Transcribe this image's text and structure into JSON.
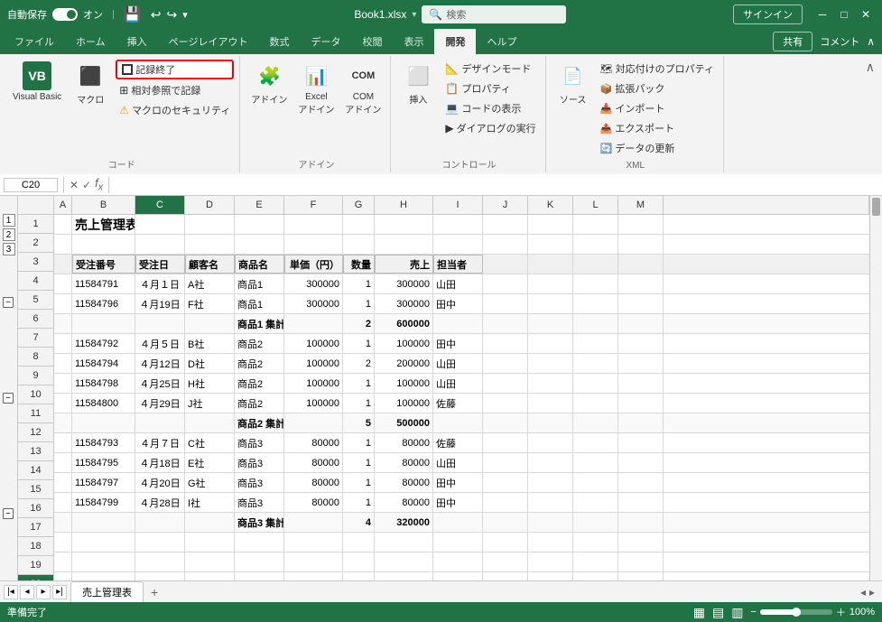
{
  "titlebar": {
    "autosave_label": "自動保存",
    "toggle_state": "オン",
    "filename": "Book1.xlsx",
    "search_placeholder": "検索",
    "signin_label": "サインイン",
    "win_min": "─",
    "win_max": "□",
    "win_close": "✕"
  },
  "ribbon": {
    "tabs": [
      "ファイル",
      "ホーム",
      "挿入",
      "ページレイアウト",
      "数式",
      "データ",
      "校閲",
      "表示",
      "開発",
      "ヘルプ"
    ],
    "active_tab": "開発",
    "share_label": "共有",
    "comment_label": "コメント",
    "groups": {
      "code": {
        "label": "コード",
        "vb_label": "Visual Basic",
        "macro_label": "マクロ",
        "record_label": "記録終了",
        "relative_label": "相対参照で記録",
        "security_label": "マクロのセキュリティ"
      },
      "addin": {
        "label": "アドイン",
        "addin_label": "アドイン",
        "excel_addin_label": "Excelアドイン",
        "com_label": "COM\nアドイン"
      },
      "insert_group": {
        "label": "アドイン",
        "insert_btn": "挿入"
      },
      "controls": {
        "label": "コントロール",
        "design_label": "デザインモード",
        "prop_label": "プロパティ",
        "code_view_label": "コードの表示",
        "dialog_label": "ダイアログの実行"
      },
      "xml": {
        "label": "XML",
        "source_label": "ソース",
        "map_prop_label": "対応付けのプロパティ",
        "extend_label": "拡張パック",
        "import_label": "インポート",
        "export_label": "エクスポート",
        "refresh_label": "データの更新"
      }
    }
  },
  "formula_bar": {
    "cell_ref": "C20",
    "formula_content": ""
  },
  "outline": {
    "levels": [
      "1",
      "2",
      "3"
    ],
    "minus_rows": [
      6,
      11,
      16
    ]
  },
  "columns": {
    "headers": [
      "A",
      "B",
      "C",
      "D",
      "E",
      "F",
      "G",
      "H",
      "I",
      "J",
      "K",
      "L",
      "M"
    ]
  },
  "sheet": {
    "title_row": "売上管理表",
    "headers": [
      "受注番号",
      "受注日",
      "顧客名",
      "商品名",
      "単価（円）",
      "数量",
      "売上",
      "担当者"
    ],
    "rows": [
      {
        "row": 4,
        "cols": [
          "11584791",
          "４月１日",
          "A社",
          "商品1",
          "300000",
          "1",
          "300000",
          "山田"
        ]
      },
      {
        "row": 5,
        "cols": [
          "11584796",
          "４月19日",
          "F社",
          "商品1",
          "300000",
          "1",
          "300000",
          "田中"
        ]
      },
      {
        "row": 6,
        "cols": [
          "",
          "",
          "",
          "商品1 集計",
          "",
          "2",
          "600000",
          ""
        ],
        "subtotal": true
      },
      {
        "row": 7,
        "cols": [
          "11584792",
          "４月５日",
          "B社",
          "商品2",
          "100000",
          "1",
          "100000",
          "田中"
        ]
      },
      {
        "row": 8,
        "cols": [
          "11584794",
          "４月12日",
          "D社",
          "商品2",
          "100000",
          "2",
          "200000",
          "山田"
        ]
      },
      {
        "row": 9,
        "cols": [
          "11584798",
          "４月25日",
          "H社",
          "商品2",
          "100000",
          "1",
          "100000",
          "山田"
        ]
      },
      {
        "row": 10,
        "cols": [
          "11584800",
          "４月29日",
          "J社",
          "商品2",
          "100000",
          "1",
          "100000",
          "佐藤"
        ]
      },
      {
        "row": 11,
        "cols": [
          "",
          "",
          "",
          "商品2 集計",
          "",
          "5",
          "500000",
          ""
        ],
        "subtotal": true
      },
      {
        "row": 12,
        "cols": [
          "11584793",
          "４月７日",
          "C社",
          "商品3",
          "80000",
          "1",
          "80000",
          "佐藤"
        ]
      },
      {
        "row": 13,
        "cols": [
          "11584795",
          "４月18日",
          "E社",
          "商品3",
          "80000",
          "1",
          "80000",
          "山田"
        ]
      },
      {
        "row": 14,
        "cols": [
          "11584797",
          "４月20日",
          "G社",
          "商品3",
          "80000",
          "1",
          "80000",
          "田中"
        ]
      },
      {
        "row": 15,
        "cols": [
          "11584799",
          "４月28日",
          "I社",
          "商品3",
          "80000",
          "1",
          "80000",
          "田中"
        ]
      },
      {
        "row": 16,
        "cols": [
          "",
          "",
          "",
          "商品3 集計",
          "",
          "4",
          "320000",
          ""
        ],
        "subtotal": true
      }
    ]
  },
  "sheet_tabs": {
    "tabs": [
      "売上管理表"
    ],
    "active": "売上管理表",
    "add_label": "+"
  },
  "status_bar": {
    "ready_label": "準備完了",
    "view_normal": "▦",
    "view_page": "▤",
    "view_custom": "▥",
    "zoom_label": "100%"
  }
}
